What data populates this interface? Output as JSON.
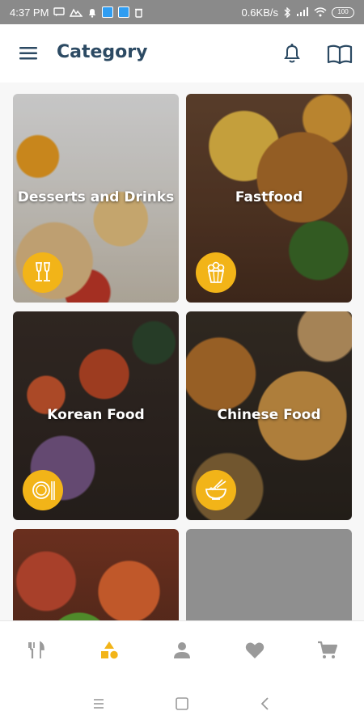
{
  "status_bar": {
    "time": "4:37 PM",
    "network_speed": "0.6KB/s",
    "battery": "100"
  },
  "app_bar": {
    "title": "Category",
    "menu_icon": "menu-icon",
    "notification_icon": "bell-icon",
    "book_icon": "book-icon"
  },
  "categories": [
    {
      "name": "Desserts and Drinks",
      "icon": "champagne-glasses-icon"
    },
    {
      "name": "Fastfood",
      "icon": "popcorn-icon"
    },
    {
      "name": "Korean Food",
      "icon": "plate-chopsticks-icon"
    },
    {
      "name": "Chinese Food",
      "icon": "noodle-bowl-icon"
    },
    {
      "name": "",
      "icon": ""
    },
    {
      "name": "",
      "icon": ""
    }
  ],
  "bottom_nav": {
    "items": [
      {
        "icon": "restaurant-icon",
        "active": false
      },
      {
        "icon": "category-icon",
        "active": true
      },
      {
        "icon": "person-icon",
        "active": false
      },
      {
        "icon": "heart-icon",
        "active": false
      },
      {
        "icon": "cart-icon",
        "active": false
      }
    ],
    "active_color": "#f2b418",
    "inactive_color": "#9a9a9a"
  },
  "colors": {
    "title": "#2c4a63",
    "accent": "#f2b418",
    "status_bar": "#8a8a8a"
  }
}
